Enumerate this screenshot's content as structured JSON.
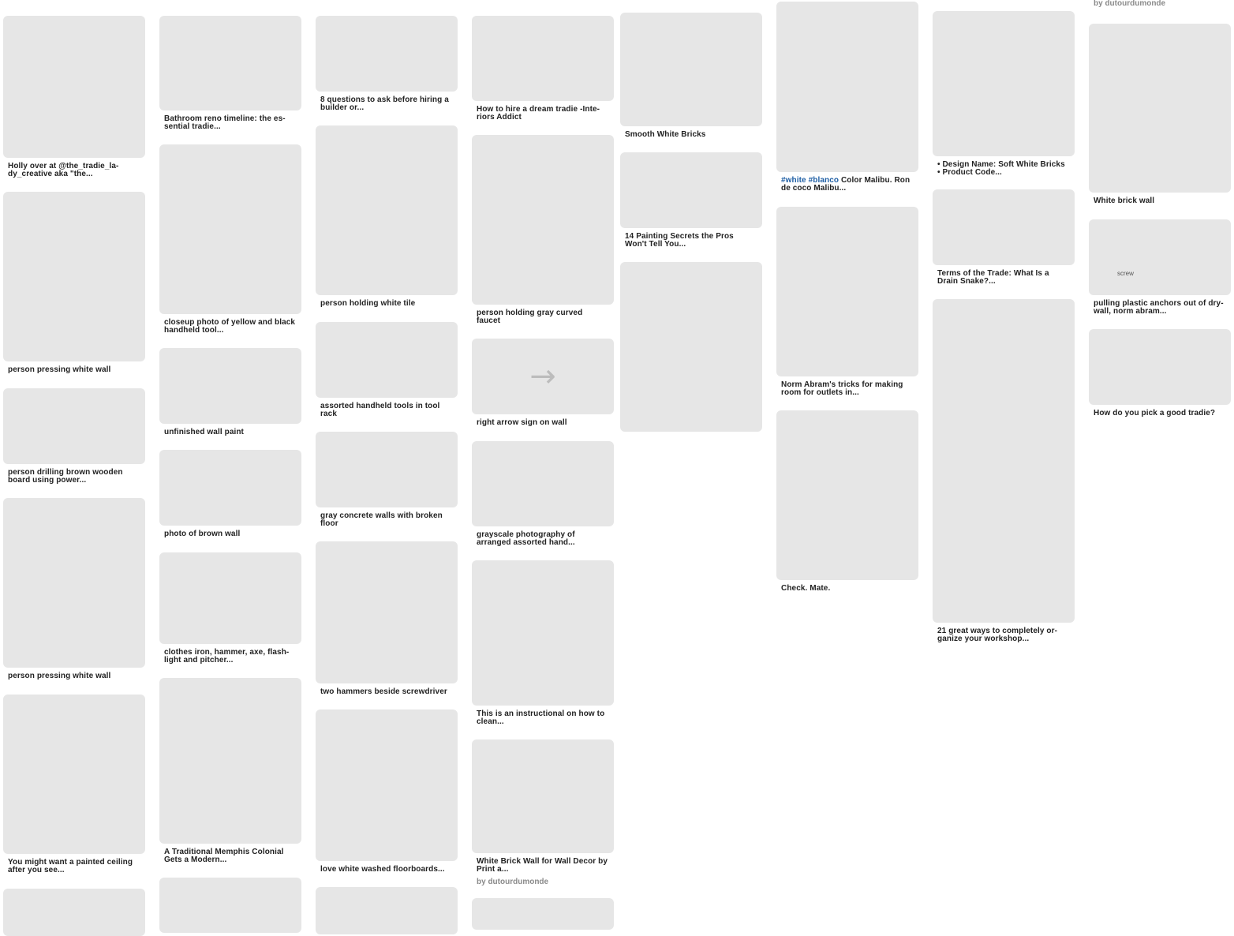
{
  "top_byline": "by dutourdumonde",
  "pins": [
    {
      "id": "c1a",
      "caption": "Holly over at @the_tradie_la-\ndy_creative aka \"the...",
      "texture": "t-bed",
      "icon": "image-icon"
    },
    {
      "id": "c1b",
      "caption": "person pressing white wall",
      "texture": "t-wall",
      "icon": "image-icon"
    },
    {
      "id": "c1c",
      "caption": "person drilling brown wooden\nboard using power...",
      "texture": "t-dark",
      "icon": "image-icon"
    },
    {
      "id": "c1d",
      "caption": "person pressing white wall",
      "texture": "t-wall",
      "icon": "image-icon"
    },
    {
      "id": "c1e",
      "caption": "You might want a painted ceiling\nafter you see...",
      "texture": "t-bath",
      "icon": "image-icon"
    },
    {
      "id": "c1f",
      "caption": "",
      "texture": "t-brick",
      "icon": "image-icon"
    },
    {
      "id": "c2a",
      "caption": "Bathroom reno timeline: the es-\nsential tradie...",
      "texture": "t-cons",
      "icon": "image-icon"
    },
    {
      "id": "c2b",
      "caption": "closeup photo of yellow and black\nhandheld tool...",
      "texture": "t-wood",
      "icon": "image-icon"
    },
    {
      "id": "c2c",
      "caption": "unfinished wall paint",
      "texture": "t-grey",
      "icon": "image-icon"
    },
    {
      "id": "c2d",
      "caption": "photo of brown wall",
      "texture": "t-paint",
      "icon": "image-icon"
    },
    {
      "id": "c2e",
      "caption": "clothes iron, hammer, axe, flash-\nlight and pitcher...",
      "texture": "t-dark",
      "icon": "image-icon"
    },
    {
      "id": "c2f",
      "caption": "A Traditional Memphis Colonial\nGets a Modern...",
      "texture": "t-house",
      "icon": "image-icon"
    },
    {
      "id": "c2g",
      "caption": "",
      "texture": "t-crack",
      "icon": "image-icon"
    },
    {
      "id": "c3a",
      "caption": "8 questions to ask before hiring a\nbuilder or...",
      "texture": "t-tradie",
      "icon": "image-icon"
    },
    {
      "id": "c3b",
      "caption": "person holding white tile",
      "texture": "t-wall",
      "icon": "image-icon"
    },
    {
      "id": "c3c",
      "caption": "assorted handheld tools in tool\nrack",
      "texture": "t-tools",
      "icon": "image-icon"
    },
    {
      "id": "c3d",
      "caption": "gray concrete walls with broken\nfloor",
      "texture": "t-room",
      "icon": "image-icon"
    },
    {
      "id": "c3e",
      "caption": "two hammers beside screwdriver",
      "texture": "t-wood",
      "icon": "image-icon"
    },
    {
      "id": "c3f",
      "caption": "love white washed floorboards...",
      "texture": "t-floor",
      "icon": "image-icon"
    },
    {
      "id": "c3g",
      "caption": "",
      "texture": "t-brick2",
      "icon": "image-icon"
    },
    {
      "id": "c4a",
      "caption": "How to hire a dream tradie -Inte-\nriors Addict",
      "texture": "t-tradie",
      "icon": "image-icon"
    },
    {
      "id": "c4b",
      "caption": "person holding gray curved\nfaucet",
      "texture": "t-wall",
      "icon": "image-icon"
    },
    {
      "id": "c4c",
      "caption": "right arrow sign on wall",
      "texture": "t-arrow",
      "icon": "arrow-right-icon",
      "glyph": "→"
    },
    {
      "id": "c4d",
      "caption": "grayscale photography of\narranged assorted hand...",
      "texture": "t-bw",
      "icon": "image-icon"
    },
    {
      "id": "c4e",
      "caption": "This is an instructional on how to\nclean...",
      "texture": "t-frame",
      "icon": "image-icon"
    },
    {
      "id": "c4f",
      "caption": "White Brick Wall for Wall Decor by\nPrint a...",
      "sub": "by dutourdumonde",
      "texture": "t-brick",
      "icon": "image-icon"
    },
    {
      "id": "c4g",
      "caption": "",
      "texture": "t-brick",
      "icon": "image-icon"
    },
    {
      "id": "c5a",
      "caption": "Smooth White Bricks",
      "texture": "t-brick",
      "icon": "image-icon"
    },
    {
      "id": "c5b",
      "caption": "14 Painting Secrets the Pros\nWon't Tell You...",
      "texture": "t-cons",
      "icon": "image-icon"
    },
    {
      "id": "c5c",
      "caption": "",
      "texture": "t-garden",
      "icon": "image-icon"
    },
    {
      "id": "c6a",
      "caption": "Color Malibu. Ron\nde coco Malibu...",
      "tags": "#white #blanco",
      "texture": "t-crack",
      "icon": "image-icon"
    },
    {
      "id": "c6b",
      "caption": "Norm Abram's tricks for making\nroom for outlets in...",
      "texture": "t-sketch",
      "icon": "image-icon"
    },
    {
      "id": "c6c",
      "caption": "Check. Mate.",
      "texture": "t-spray",
      "icon": "image-icon"
    },
    {
      "id": "c7a",
      "caption": "• Design Name: Soft White Bricks\n• Product Code...",
      "texture": "t-brick2",
      "icon": "image-icon"
    },
    {
      "id": "c7b",
      "caption": "Terms of the Trade: What Is a\nDrain Snake?...",
      "texture": "t-snake",
      "icon": "image-icon"
    },
    {
      "id": "c7c",
      "caption": "21 great ways to completely or-\nganize your workshop...",
      "texture": "t-wardrobe",
      "icon": "image-icon"
    },
    {
      "id": "c8a",
      "caption": "White brick wall",
      "texture": "t-brick2",
      "icon": "image-icon"
    },
    {
      "id": "c8b",
      "caption": "pulling plastic anchors out of dry-\nwall, norm abram...",
      "texture": "t-sketch",
      "icon": "image-icon",
      "glyph_text": "screw"
    },
    {
      "id": "c8c",
      "caption": "How do you pick a good tradie?",
      "texture": "t-safety",
      "icon": "image-icon"
    }
  ]
}
